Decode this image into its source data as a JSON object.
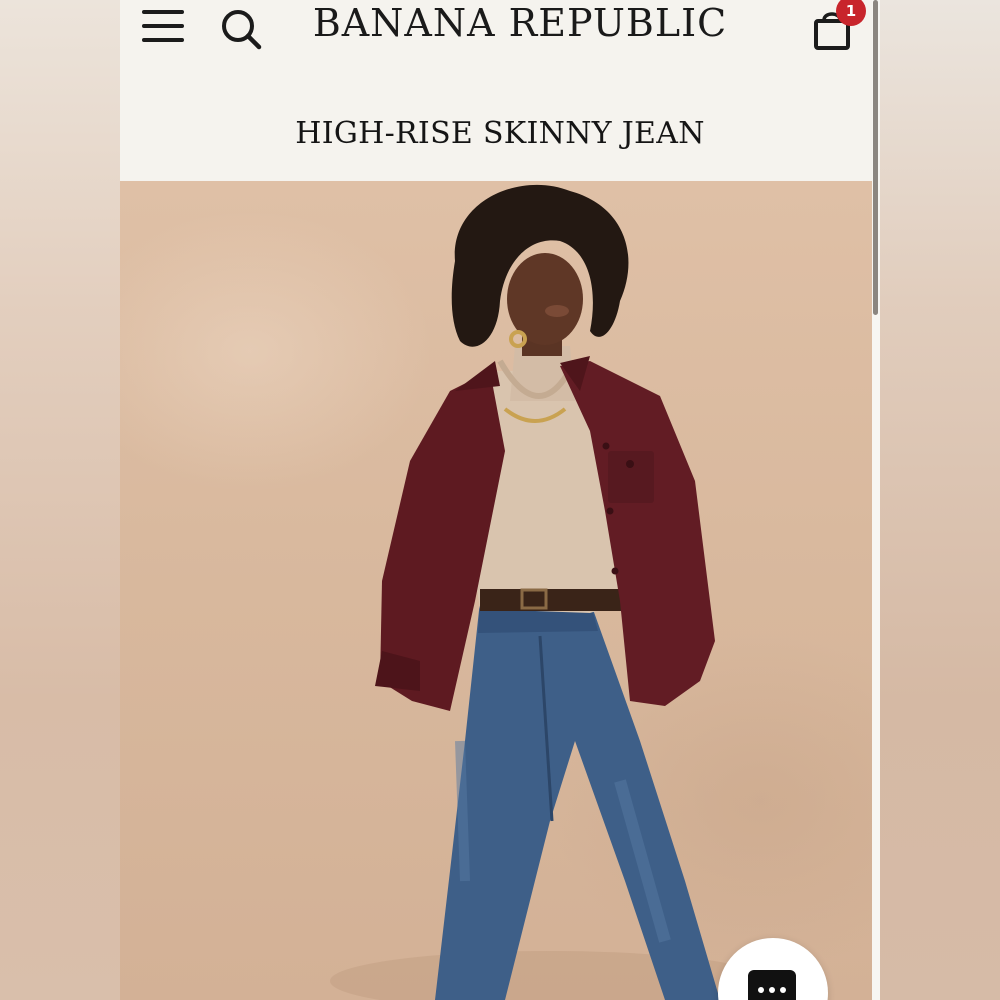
{
  "header": {
    "brand": "BANANA REPUBLIC",
    "menu_icon": "hamburger-menu-icon",
    "search_icon": "search-icon",
    "bag_icon": "shopping-bag-icon",
    "bag_count": "1"
  },
  "product": {
    "title": "HIGH-RISE SKINNY JEAN"
  },
  "chat": {
    "icon": "chat-ellipsis-icon"
  },
  "colors": {
    "header_bg": "#f5f3ee",
    "badge": "#c8252c",
    "text": "#1a1a1a"
  }
}
